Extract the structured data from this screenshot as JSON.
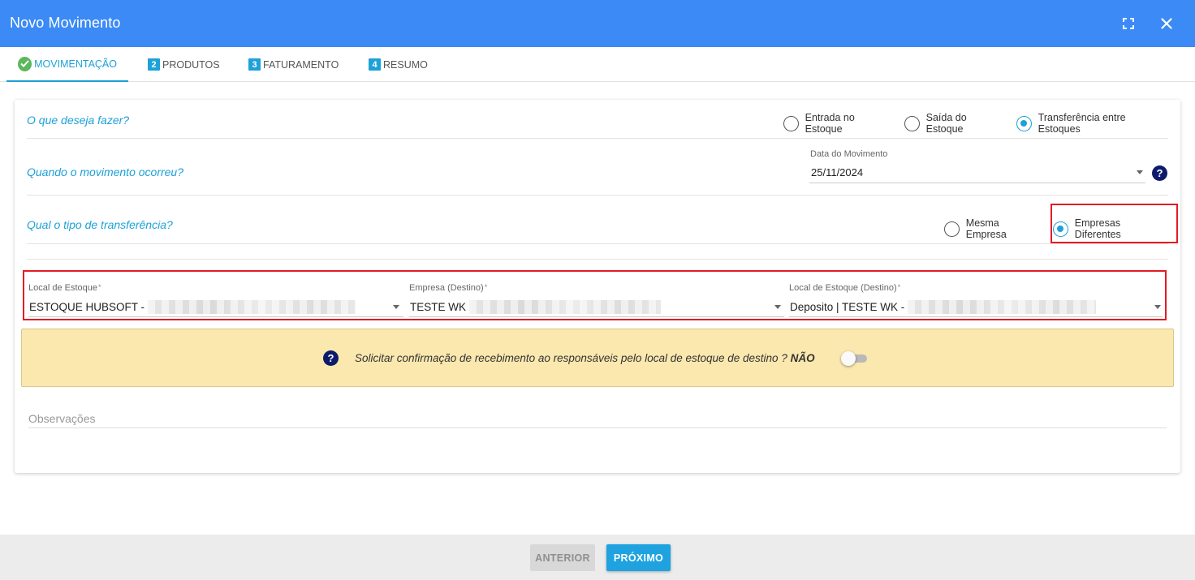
{
  "window": {
    "title": "Novo Movimento"
  },
  "tabs": [
    {
      "num": "",
      "label": "MOVIMENTAÇÃO"
    },
    {
      "num": "2",
      "label": "PRODUTOS"
    },
    {
      "num": "3",
      "label": "FATURAMENTO"
    },
    {
      "num": "4",
      "label": "RESUMO"
    }
  ],
  "form": {
    "q1": {
      "question": "O que deseja fazer?",
      "options": [
        "Entrada no Estoque",
        "Saída do Estoque",
        "Transferência entre Estoques"
      ],
      "selected": "Transferência entre Estoques"
    },
    "q2": {
      "question": "Quando o movimento ocorreu?",
      "date_label": "Data do Movimento",
      "date_value": "25/11/2024",
      "help_icon": "?"
    },
    "q3": {
      "question": "Qual o tipo de transferência?",
      "options": [
        "Mesma Empresa",
        "Empresas Diferentes"
      ],
      "selected": "Empresas Diferentes"
    },
    "fields": [
      {
        "label": "Local de Estoque",
        "required": "*",
        "value": "ESTOQUE HUBSOFT -"
      },
      {
        "label": "Empresa (Destino)",
        "required": "*",
        "value": "TESTE WK"
      },
      {
        "label": "Local de Estoque (Destino)",
        "required": "*",
        "value": "Deposito | TESTE WK -"
      }
    ],
    "confirmation": {
      "help_icon": "?",
      "text": "Solicitar confirmação de recebimento ao responsáveis pelo local de estoque de destino ?",
      "status": "NÃO",
      "enabled": false
    },
    "observations_placeholder": "Observações"
  },
  "footer": {
    "prev_label": "ANTERIOR",
    "next_label": "PRÓXIMO"
  },
  "colors": {
    "titlebar": "#3b8af6",
    "accent": "#1da1d8",
    "highlight": "#e31b23",
    "banner": "#fbe8ae"
  }
}
